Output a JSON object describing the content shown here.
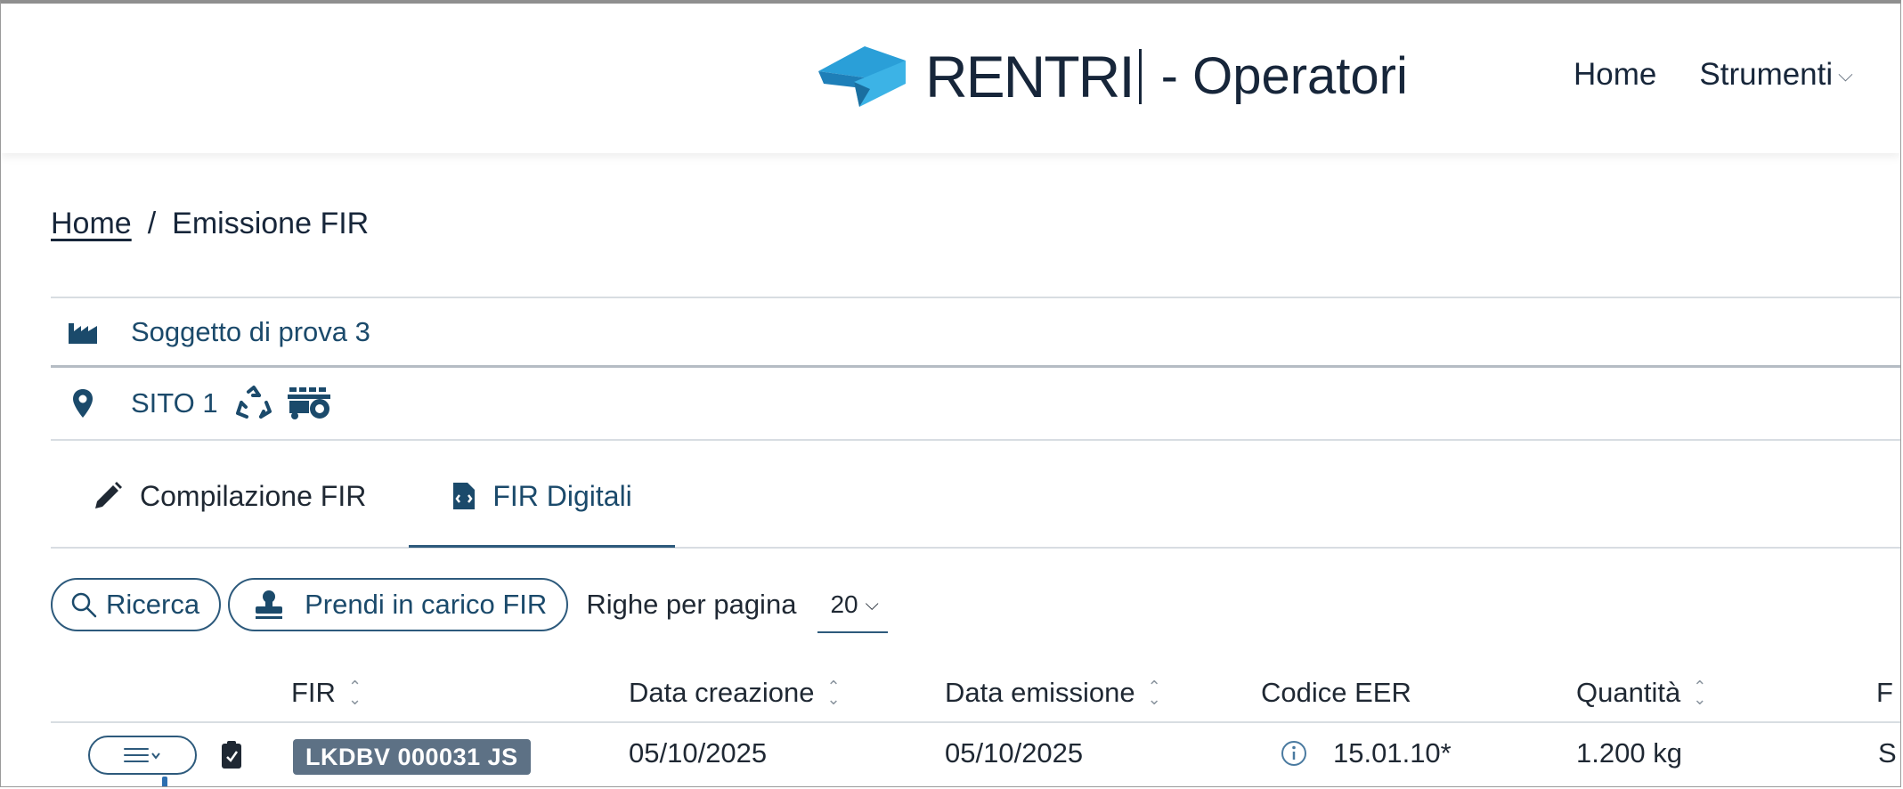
{
  "header": {
    "brand": "RENTRI",
    "subtitle": "- Operatori",
    "nav": [
      {
        "label": "Home"
      },
      {
        "label": "Strumenti"
      }
    ]
  },
  "breadcrumb": {
    "home": "Home",
    "separator": "/",
    "current": "Emissione FIR"
  },
  "context": {
    "soggetto": "Soggetto di prova 3",
    "sito": "SITO 1",
    "icons": [
      "factory-icon",
      "map-pin-icon",
      "recycle-icon",
      "waste-truck-icon"
    ]
  },
  "tabs": [
    {
      "label": "Compilazione FIR",
      "icon": "pencil-icon",
      "active": false
    },
    {
      "label": "FIR Digitali",
      "icon": "document-icon",
      "active": true
    }
  ],
  "toolbar": {
    "search_label": "Ricerca",
    "take_charge_label": "Prendi in carico FIR",
    "rows_per_page_label": "Righe per pagina",
    "rows_per_page_value": "20"
  },
  "table": {
    "columns": [
      "FIR",
      "Data creazione",
      "Data emissione",
      "Codice EER",
      "Quantità",
      "F"
    ],
    "rows": [
      {
        "fir": "LKDBV 000031 JS",
        "data_creazione": "05/10/2025",
        "data_emissione": "05/10/2025",
        "codice_eer": "15.01.10*",
        "quantita": "1.200 kg",
        "next": "S"
      }
    ]
  },
  "colors": {
    "primary": "#2d5a7c",
    "text_dark": "#17263a",
    "link_blue": "#1b4a6b",
    "logo_blue": "#2a9fd8",
    "badge_bg": "#5d7185"
  }
}
